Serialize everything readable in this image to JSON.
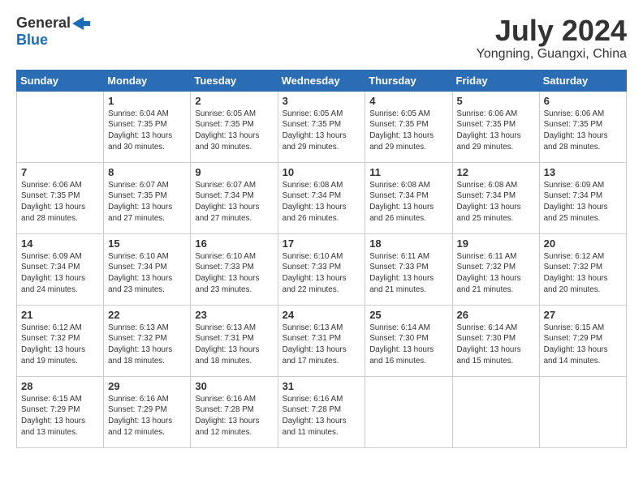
{
  "logo": {
    "general": "General",
    "blue": "Blue"
  },
  "title": "July 2024",
  "subtitle": "Yongning, Guangxi, China",
  "weekdays": [
    "Sunday",
    "Monday",
    "Tuesday",
    "Wednesday",
    "Thursday",
    "Friday",
    "Saturday"
  ],
  "weeks": [
    [
      {
        "day": "",
        "sunrise": "",
        "sunset": "",
        "daylight": ""
      },
      {
        "day": "1",
        "sunrise": "Sunrise: 6:04 AM",
        "sunset": "Sunset: 7:35 PM",
        "daylight": "Daylight: 13 hours and 30 minutes."
      },
      {
        "day": "2",
        "sunrise": "Sunrise: 6:05 AM",
        "sunset": "Sunset: 7:35 PM",
        "daylight": "Daylight: 13 hours and 30 minutes."
      },
      {
        "day": "3",
        "sunrise": "Sunrise: 6:05 AM",
        "sunset": "Sunset: 7:35 PM",
        "daylight": "Daylight: 13 hours and 29 minutes."
      },
      {
        "day": "4",
        "sunrise": "Sunrise: 6:05 AM",
        "sunset": "Sunset: 7:35 PM",
        "daylight": "Daylight: 13 hours and 29 minutes."
      },
      {
        "day": "5",
        "sunrise": "Sunrise: 6:06 AM",
        "sunset": "Sunset: 7:35 PM",
        "daylight": "Daylight: 13 hours and 29 minutes."
      },
      {
        "day": "6",
        "sunrise": "Sunrise: 6:06 AM",
        "sunset": "Sunset: 7:35 PM",
        "daylight": "Daylight: 13 hours and 28 minutes."
      }
    ],
    [
      {
        "day": "7",
        "sunrise": "Sunrise: 6:06 AM",
        "sunset": "Sunset: 7:35 PM",
        "daylight": "Daylight: 13 hours and 28 minutes."
      },
      {
        "day": "8",
        "sunrise": "Sunrise: 6:07 AM",
        "sunset": "Sunset: 7:35 PM",
        "daylight": "Daylight: 13 hours and 27 minutes."
      },
      {
        "day": "9",
        "sunrise": "Sunrise: 6:07 AM",
        "sunset": "Sunset: 7:34 PM",
        "daylight": "Daylight: 13 hours and 27 minutes."
      },
      {
        "day": "10",
        "sunrise": "Sunrise: 6:08 AM",
        "sunset": "Sunset: 7:34 PM",
        "daylight": "Daylight: 13 hours and 26 minutes."
      },
      {
        "day": "11",
        "sunrise": "Sunrise: 6:08 AM",
        "sunset": "Sunset: 7:34 PM",
        "daylight": "Daylight: 13 hours and 26 minutes."
      },
      {
        "day": "12",
        "sunrise": "Sunrise: 6:08 AM",
        "sunset": "Sunset: 7:34 PM",
        "daylight": "Daylight: 13 hours and 25 minutes."
      },
      {
        "day": "13",
        "sunrise": "Sunrise: 6:09 AM",
        "sunset": "Sunset: 7:34 PM",
        "daylight": "Daylight: 13 hours and 25 minutes."
      }
    ],
    [
      {
        "day": "14",
        "sunrise": "Sunrise: 6:09 AM",
        "sunset": "Sunset: 7:34 PM",
        "daylight": "Daylight: 13 hours and 24 minutes."
      },
      {
        "day": "15",
        "sunrise": "Sunrise: 6:10 AM",
        "sunset": "Sunset: 7:34 PM",
        "daylight": "Daylight: 13 hours and 23 minutes."
      },
      {
        "day": "16",
        "sunrise": "Sunrise: 6:10 AM",
        "sunset": "Sunset: 7:33 PM",
        "daylight": "Daylight: 13 hours and 23 minutes."
      },
      {
        "day": "17",
        "sunrise": "Sunrise: 6:10 AM",
        "sunset": "Sunset: 7:33 PM",
        "daylight": "Daylight: 13 hours and 22 minutes."
      },
      {
        "day": "18",
        "sunrise": "Sunrise: 6:11 AM",
        "sunset": "Sunset: 7:33 PM",
        "daylight": "Daylight: 13 hours and 21 minutes."
      },
      {
        "day": "19",
        "sunrise": "Sunrise: 6:11 AM",
        "sunset": "Sunset: 7:32 PM",
        "daylight": "Daylight: 13 hours and 21 minutes."
      },
      {
        "day": "20",
        "sunrise": "Sunrise: 6:12 AM",
        "sunset": "Sunset: 7:32 PM",
        "daylight": "Daylight: 13 hours and 20 minutes."
      }
    ],
    [
      {
        "day": "21",
        "sunrise": "Sunrise: 6:12 AM",
        "sunset": "Sunset: 7:32 PM",
        "daylight": "Daylight: 13 hours and 19 minutes."
      },
      {
        "day": "22",
        "sunrise": "Sunrise: 6:13 AM",
        "sunset": "Sunset: 7:32 PM",
        "daylight": "Daylight: 13 hours and 18 minutes."
      },
      {
        "day": "23",
        "sunrise": "Sunrise: 6:13 AM",
        "sunset": "Sunset: 7:31 PM",
        "daylight": "Daylight: 13 hours and 18 minutes."
      },
      {
        "day": "24",
        "sunrise": "Sunrise: 6:13 AM",
        "sunset": "Sunset: 7:31 PM",
        "daylight": "Daylight: 13 hours and 17 minutes."
      },
      {
        "day": "25",
        "sunrise": "Sunrise: 6:14 AM",
        "sunset": "Sunset: 7:30 PM",
        "daylight": "Daylight: 13 hours and 16 minutes."
      },
      {
        "day": "26",
        "sunrise": "Sunrise: 6:14 AM",
        "sunset": "Sunset: 7:30 PM",
        "daylight": "Daylight: 13 hours and 15 minutes."
      },
      {
        "day": "27",
        "sunrise": "Sunrise: 6:15 AM",
        "sunset": "Sunset: 7:29 PM",
        "daylight": "Daylight: 13 hours and 14 minutes."
      }
    ],
    [
      {
        "day": "28",
        "sunrise": "Sunrise: 6:15 AM",
        "sunset": "Sunset: 7:29 PM",
        "daylight": "Daylight: 13 hours and 13 minutes."
      },
      {
        "day": "29",
        "sunrise": "Sunrise: 6:16 AM",
        "sunset": "Sunset: 7:29 PM",
        "daylight": "Daylight: 13 hours and 12 minutes."
      },
      {
        "day": "30",
        "sunrise": "Sunrise: 6:16 AM",
        "sunset": "Sunset: 7:28 PM",
        "daylight": "Daylight: 13 hours and 12 minutes."
      },
      {
        "day": "31",
        "sunrise": "Sunrise: 6:16 AM",
        "sunset": "Sunset: 7:28 PM",
        "daylight": "Daylight: 13 hours and 11 minutes."
      },
      {
        "day": "",
        "sunrise": "",
        "sunset": "",
        "daylight": ""
      },
      {
        "day": "",
        "sunrise": "",
        "sunset": "",
        "daylight": ""
      },
      {
        "day": "",
        "sunrise": "",
        "sunset": "",
        "daylight": ""
      }
    ]
  ]
}
